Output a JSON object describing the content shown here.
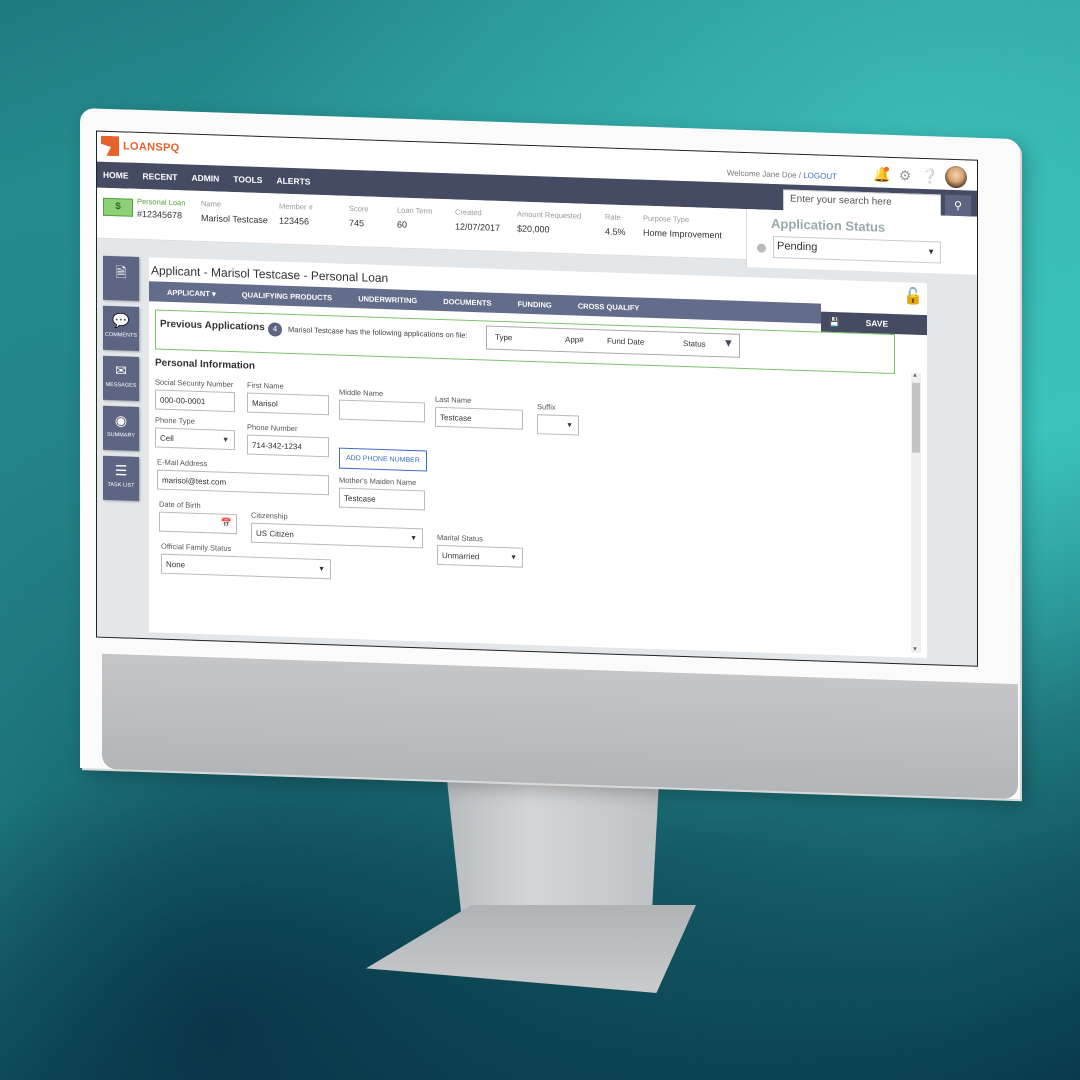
{
  "app": {
    "brand": "LOANSPQ",
    "brand_color": "#e8612c"
  },
  "topbar": {
    "welcome": "Welcome Jane Doe / ",
    "logout": "LOGOUT"
  },
  "nav": {
    "items": [
      "HOME",
      "RECENT",
      "ADMIN",
      "TOOLS",
      "ALERTS"
    ],
    "search_placeholder": "Enter your search here"
  },
  "loan_info": {
    "type_label": "Personal Loan",
    "loan_number": "#12345678",
    "fields": [
      {
        "label": "Name",
        "value": "Marisol Testcase"
      },
      {
        "label": "Member #",
        "value": "123456"
      },
      {
        "label": "Score",
        "value": "745"
      },
      {
        "label": "Loan Term",
        "value": "60"
      },
      {
        "label": "Created",
        "value": "12/07/2017"
      },
      {
        "label": "Amount Requested",
        "value": "$20,000"
      },
      {
        "label": "Rate",
        "value": "4.5%"
      },
      {
        "label": "Purpose Type",
        "value": "Home Improvement"
      }
    ]
  },
  "status": {
    "title": "Application Status",
    "value": "Pending"
  },
  "sidebar": {
    "items": [
      {
        "label": "",
        "icon": "document-icon"
      },
      {
        "label": "COMMENTS",
        "icon": "comment-icon"
      },
      {
        "label": "MESSAGES",
        "icon": "envelope-icon"
      },
      {
        "label": "SUMMARY",
        "icon": "eye-icon"
      },
      {
        "label": "TASK LIST",
        "icon": "list-icon"
      }
    ]
  },
  "card": {
    "title": "Applicant - Marisol Testcase - Personal Loan",
    "tabs": [
      "APPLICANT ▾",
      "QUALIFYING PRODUCTS",
      "UNDERWRITING",
      "DOCUMENTS",
      "FUNDING",
      "CROSS QUALIFY"
    ],
    "save_label": "SAVE"
  },
  "previous_applications": {
    "title": "Previous Applications",
    "count": "4",
    "text": "Marisol Testcase has the following applications on file:",
    "columns": [
      "Type",
      "App#",
      "Fund Date",
      "Status"
    ]
  },
  "personal_info": {
    "title": "Personal Information",
    "ssn": {
      "label": "Social Security Number",
      "value": "000-00-0001"
    },
    "first_name": {
      "label": "First Name",
      "value": "Marisol"
    },
    "middle_name": {
      "label": "Middle Name",
      "value": ""
    },
    "last_name": {
      "label": "Last Name",
      "value": "Testcase"
    },
    "suffix": {
      "label": "Suffix",
      "value": ""
    },
    "phone_type": {
      "label": "Phone Type",
      "value": "Cell"
    },
    "phone_number": {
      "label": "Phone Number",
      "value": "714-342-1234"
    },
    "add_phone": "ADD PHONE NUMBER",
    "email": {
      "label": "E-Mail Address",
      "value": "marisol@test.com"
    },
    "maiden_name": {
      "label": "Mother's Maiden Name",
      "value": "Testcase"
    },
    "dob": {
      "label": "Date of Birth",
      "value": ""
    },
    "citizenship": {
      "label": "Citizenship",
      "value": "US Citizen"
    },
    "marital_status": {
      "label": "Marital Status",
      "value": "Unmarried"
    },
    "family_status": {
      "label": "Official Family Status",
      "value": "None"
    }
  }
}
